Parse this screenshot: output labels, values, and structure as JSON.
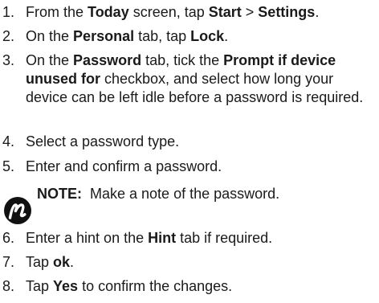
{
  "steps": [
    {
      "num": "1.",
      "parts": [
        {
          "t": "From the "
        },
        {
          "t": "Today",
          "b": true
        },
        {
          "t": " screen, tap "
        },
        {
          "t": "Start",
          "b": true
        },
        {
          "t": " > "
        },
        {
          "t": "Settings",
          "b": true
        },
        {
          "t": "."
        }
      ]
    },
    {
      "num": "2.",
      "parts": [
        {
          "t": "On the "
        },
        {
          "t": "Personal",
          "b": true
        },
        {
          "t": " tab, tap "
        },
        {
          "t": "Lock",
          "b": true
        },
        {
          "t": "."
        }
      ]
    },
    {
      "num": "3.",
      "parts": [
        {
          "t": "On the "
        },
        {
          "t": "Password",
          "b": true
        },
        {
          "t": " tab, tick the "
        },
        {
          "t": "Prompt if device unused for",
          "b": true
        },
        {
          "t": " checkbox, and select how long your device can be left idle before a password is required."
        }
      ]
    },
    {
      "num": "4.",
      "parts": [
        {
          "t": "Select a password type."
        }
      ]
    },
    {
      "num": "5.",
      "parts": [
        {
          "t": "Enter and confirm a password."
        }
      ]
    },
    {
      "num": "6.",
      "parts": [
        {
          "t": "Enter a hint on the "
        },
        {
          "t": "Hint",
          "b": true
        },
        {
          "t": " tab if required."
        }
      ]
    },
    {
      "num": "7.",
      "parts": [
        {
          "t": "Tap "
        },
        {
          "t": "ok",
          "b": true
        },
        {
          "t": "."
        }
      ]
    },
    {
      "num": "8.",
      "parts": [
        {
          "t": "Tap "
        },
        {
          "t": "Yes",
          "b": true
        },
        {
          "t": " to confirm the changes."
        }
      ]
    }
  ],
  "note": {
    "label": "NOTE:",
    "text": "Make a note of the password.",
    "icon": "note-icon"
  }
}
